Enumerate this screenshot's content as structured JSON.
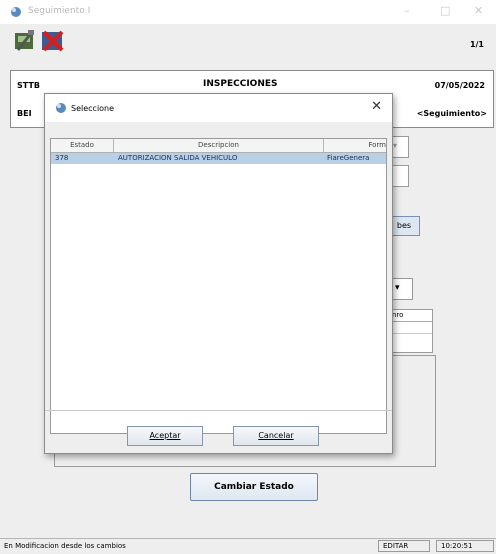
{
  "window": {
    "title": "Seguimiento I",
    "controls": [
      "–",
      "□",
      "✕"
    ]
  },
  "toolbar": {
    "page_indicator": "1/1",
    "save_icon": "tools-save-icon",
    "cancel_icon": "red-x-icon"
  },
  "header": {
    "org": "STTB",
    "section": "INSPECCIONES",
    "date": "07/05/2022",
    "initials": "BEI",
    "mode_tag": "<Seguimiento>"
  },
  "background_form": {
    "side_button_label": "bes",
    "list_header": "nro",
    "action_button": "Cambiar Estado"
  },
  "dialog": {
    "title": "Seleccione",
    "close_glyph": "✕",
    "table": {
      "columns": [
        "Estado",
        "Descripcion",
        "Form"
      ],
      "rows": [
        {
          "estado": "378",
          "descripcion": "AUTORIZACION SALIDA VEHICULO",
          "form": "FiareGenera"
        }
      ]
    },
    "buttons": {
      "accept": "Aceptar",
      "cancel": "Cancelar"
    }
  },
  "statusbar": {
    "message": "En Modificacion desde los cambios",
    "mode": "EDITAR",
    "time": "10:20:51"
  },
  "colors": {
    "selected_row": "#b8cfe5",
    "button_border": "#6f86a8"
  }
}
